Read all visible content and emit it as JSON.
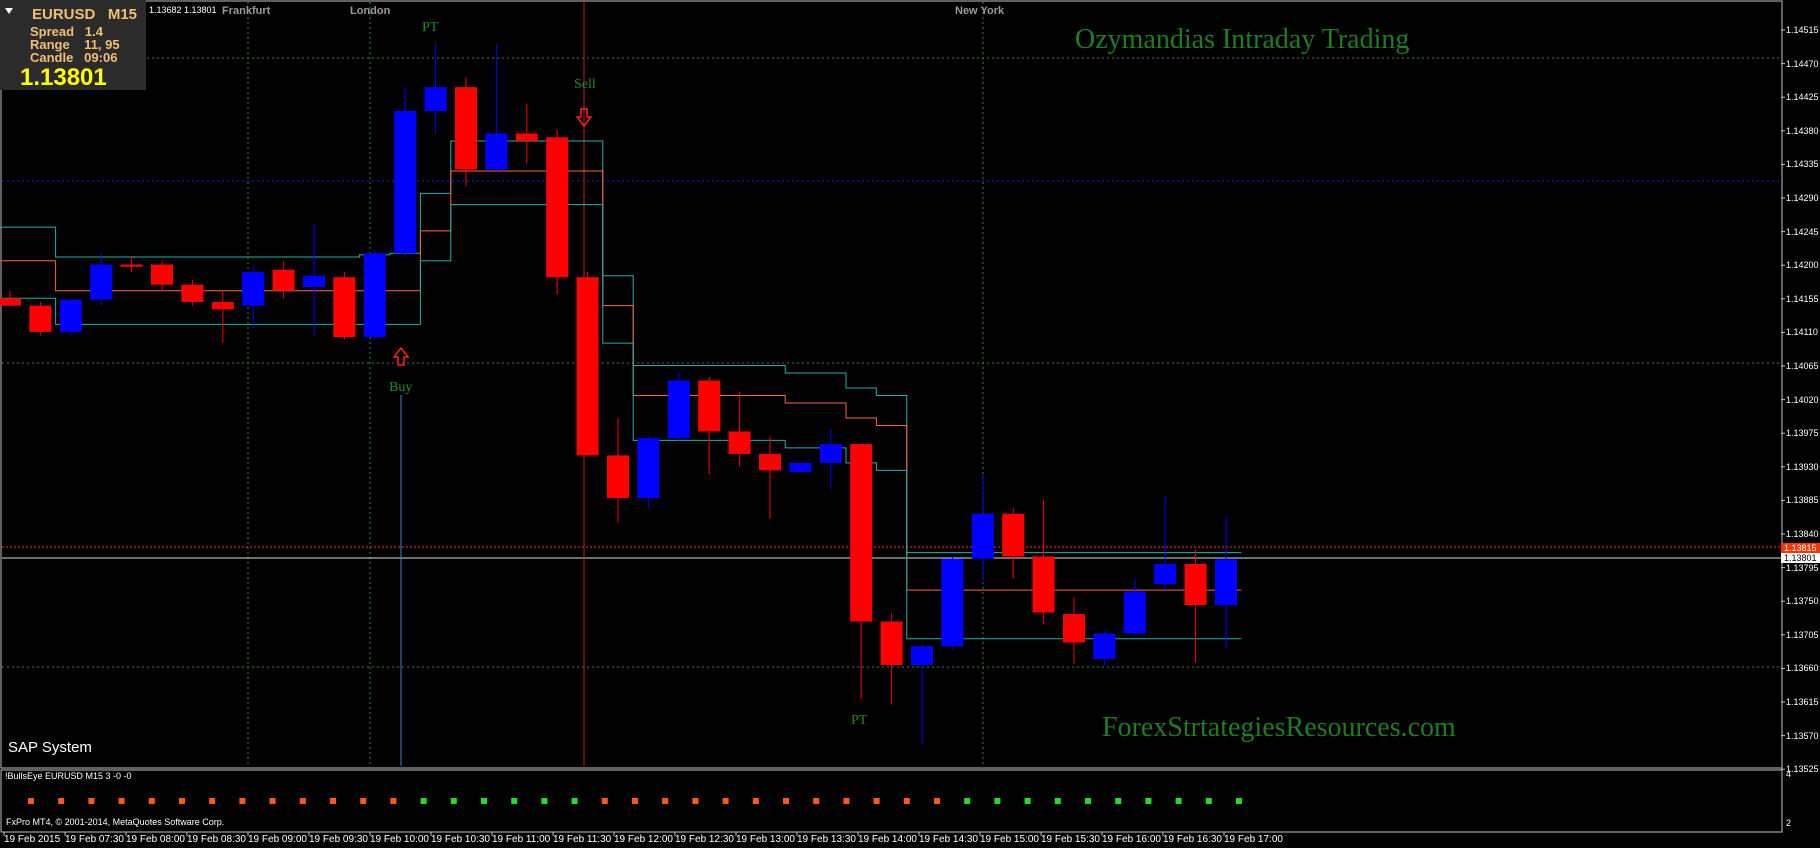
{
  "header": {
    "ohlc": "1.13682 1.13801",
    "symbol_line": "EURUSD   M15",
    "spread_line": "Spread   1.4",
    "range_line": "Range    11, 95",
    "candle_line": "Candle   09:06",
    "current_price": "1.13801"
  },
  "sessions": [
    "Frankfurt",
    "London",
    "New York"
  ],
  "titles": {
    "main": "Ozymandias Intraday Trading",
    "footer": "ForexStrtategiesResources.com",
    "system": "SAP System"
  },
  "signals": {
    "buy": "Buy",
    "sell": "Sell",
    "pt_top": "PT",
    "pt_bottom": "PT"
  },
  "indicator": {
    "label": "!BullsEye EURUSD M15 3 -0 -0",
    "scale_top": "4",
    "scale_bottom": "2",
    "dots_colors": [
      "#ff5a14",
      "#22dd22"
    ],
    "dots": [
      "o",
      "o",
      "o",
      "o",
      "o",
      "o",
      "o",
      "o",
      "o",
      "o",
      "o",
      "o",
      "o",
      "g",
      "g",
      "g",
      "g",
      "g",
      "g",
      "o",
      "o",
      "o",
      "o",
      "o",
      "o",
      "o",
      "o",
      "o",
      "o",
      "o",
      "o",
      "g",
      "g",
      "g",
      "g",
      "g",
      "g",
      "g",
      "g",
      "g",
      "g"
    ]
  },
  "copyright": "FxPro MT4, © 2001-2014, MetaQuotes Software Corp.",
  "price_axis": [
    "1.14515",
    "1.14470",
    "1.14425",
    "1.14380",
    "1.14335",
    "1.14290",
    "1.14245",
    "1.14200",
    "1.14155",
    "1.14110",
    "1.14065",
    "1.14020",
    "1.13975",
    "1.13930",
    "1.13885",
    "1.13840",
    "1.13795",
    "1.13750",
    "1.13705",
    "1.13660",
    "1.13615",
    "1.13570",
    "1.13525"
  ],
  "price_tags": {
    "red": "1.13815",
    "white": "1.13801"
  },
  "time_axis": [
    "19 Feb 2015",
    "19 Feb 07:30",
    "19 Feb 08:00",
    "19 Feb 08:30",
    "19 Feb 09:00",
    "19 Feb 09:30",
    "19 Feb 10:00",
    "19 Feb 10:30",
    "19 Feb 11:00",
    "19 Feb 11:30",
    "19 Feb 12:00",
    "19 Feb 12:30",
    "19 Feb 13:00",
    "19 Feb 13:30",
    "19 Feb 14:00",
    "19 Feb 14:30",
    "19 Feb 15:00",
    "19 Feb 15:30",
    "19 Feb 16:00",
    "19 Feb 16:30",
    "19 Feb 17:00"
  ],
  "colors": {
    "bull": "#0000ff",
    "bear": "#ff0000",
    "band_outer": "#20b2aa",
    "band_mid": "#ff6347",
    "grid": "#2e8b57"
  },
  "chart_data": {
    "type": "candlestick",
    "symbol": "EURUSD",
    "timeframe": "M15",
    "candles": [
      {
        "o": 1.1415,
        "h": 1.1416,
        "l": 1.1414,
        "c": 1.1414
      },
      {
        "o": 1.1414,
        "h": 1.14145,
        "l": 1.141,
        "c": 1.14105
      },
      {
        "o": 1.14105,
        "h": 1.1415,
        "l": 1.141,
        "c": 1.14148
      },
      {
        "o": 1.14148,
        "h": 1.1421,
        "l": 1.1414,
        "c": 1.14195
      },
      {
        "o": 1.14195,
        "h": 1.14205,
        "l": 1.14185,
        "c": 1.14192
      },
      {
        "o": 1.14195,
        "h": 1.142,
        "l": 1.1416,
        "c": 1.14168
      },
      {
        "o": 1.14168,
        "h": 1.14175,
        "l": 1.1414,
        "c": 1.14145
      },
      {
        "o": 1.14145,
        "h": 1.1416,
        "l": 1.1409,
        "c": 1.14135
      },
      {
        "o": 1.1414,
        "h": 1.14195,
        "l": 1.1411,
        "c": 1.14185
      },
      {
        "o": 1.14188,
        "h": 1.142,
        "l": 1.1415,
        "c": 1.1416
      },
      {
        "o": 1.14165,
        "h": 1.1425,
        "l": 1.141,
        "c": 1.1418
      },
      {
        "o": 1.14178,
        "h": 1.14185,
        "l": 1.14095,
        "c": 1.14098
      },
      {
        "o": 1.14098,
        "h": 1.14215,
        "l": 1.14095,
        "c": 1.1421
      },
      {
        "o": 1.1421,
        "h": 1.14432,
        "l": 1.14205,
        "c": 1.144
      },
      {
        "o": 1.144,
        "h": 1.1449,
        "l": 1.1437,
        "c": 1.14432
      },
      {
        "o": 1.14432,
        "h": 1.14445,
        "l": 1.143,
        "c": 1.14322
      },
      {
        "o": 1.14322,
        "h": 1.1449,
        "l": 1.1432,
        "c": 1.1437
      },
      {
        "o": 1.1437,
        "h": 1.1441,
        "l": 1.1433,
        "c": 1.1436
      },
      {
        "o": 1.14365,
        "h": 1.14375,
        "l": 1.14155,
        "c": 1.14178
      },
      {
        "o": 1.14178,
        "h": 1.14185,
        "l": 1.13945,
        "c": 1.1394
      },
      {
        "o": 1.1394,
        "h": 1.1399,
        "l": 1.1385,
        "c": 1.13883
      },
      {
        "o": 1.13883,
        "h": 1.13965,
        "l": 1.1387,
        "c": 1.13963
      },
      {
        "o": 1.13963,
        "h": 1.1405,
        "l": 1.1396,
        "c": 1.1404
      },
      {
        "o": 1.1404,
        "h": 1.14045,
        "l": 1.13915,
        "c": 1.13972
      },
      {
        "o": 1.13972,
        "h": 1.14025,
        "l": 1.13925,
        "c": 1.13942
      },
      {
        "o": 1.13942,
        "h": 1.13965,
        "l": 1.13855,
        "c": 1.1392
      },
      {
        "o": 1.13918,
        "h": 1.1393,
        "l": 1.13917,
        "c": 1.1393
      },
      {
        "o": 1.1393,
        "h": 1.13975,
        "l": 1.13895,
        "c": 1.13955
      },
      {
        "o": 1.13955,
        "h": 1.13955,
        "l": 1.13615,
        "c": 1.13718
      },
      {
        "o": 1.13718,
        "h": 1.13728,
        "l": 1.13607,
        "c": 1.1366
      },
      {
        "o": 1.1366,
        "h": 1.13688,
        "l": 1.13555,
        "c": 1.13685
      },
      {
        "o": 1.13685,
        "h": 1.13805,
        "l": 1.1368,
        "c": 1.13802
      },
      {
        "o": 1.13802,
        "h": 1.13915,
        "l": 1.1377,
        "c": 1.13862
      },
      {
        "o": 1.13862,
        "h": 1.1387,
        "l": 1.13775,
        "c": 1.13805
      },
      {
        "o": 1.13805,
        "h": 1.1388,
        "l": 1.13715,
        "c": 1.1373
      },
      {
        "o": 1.13728,
        "h": 1.1375,
        "l": 1.13662,
        "c": 1.1369
      },
      {
        "o": 1.13668,
        "h": 1.13705,
        "l": 1.1366,
        "c": 1.13702
      },
      {
        "o": 1.13702,
        "h": 1.13775,
        "l": 1.137,
        "c": 1.13758
      },
      {
        "o": 1.13768,
        "h": 1.13885,
        "l": 1.1376,
        "c": 1.13795
      },
      {
        "o": 1.13795,
        "h": 1.13815,
        "l": 1.13663,
        "c": 1.1374
      },
      {
        "o": 1.1374,
        "h": 1.13858,
        "l": 1.13682,
        "c": 1.13801
      }
    ],
    "band_upper": [
      1.14245,
      1.14245,
      1.14205,
      1.14205,
      1.14205,
      1.14205,
      1.14205,
      1.14205,
      1.14205,
      1.14205,
      1.14205,
      1.14205,
      1.14208,
      1.1421,
      1.1429,
      1.1436,
      1.1436,
      1.1436,
      1.1436,
      1.1436,
      1.1418,
      1.1406,
      1.1406,
      1.1406,
      1.1406,
      1.1406,
      1.1405,
      1.1405,
      1.1403,
      1.1402,
      1.1381,
      1.1381,
      1.1381,
      1.1381,
      1.1381,
      1.1381,
      1.1381,
      1.1381,
      1.1381,
      1.1381,
      1.1381
    ],
    "band_mid": [
      1.142,
      1.142,
      1.1416,
      1.1416,
      1.1416,
      1.1416,
      1.1416,
      1.1416,
      1.1416,
      1.1416,
      1.1416,
      1.1416,
      1.1416,
      1.1416,
      1.1424,
      1.1432,
      1.1432,
      1.1432,
      1.1432,
      1.1432,
      1.1414,
      1.1402,
      1.1402,
      1.1402,
      1.1402,
      1.1402,
      1.1401,
      1.1401,
      1.1399,
      1.1398,
      1.1376,
      1.1376,
      1.1376,
      1.1376,
      1.1376,
      1.1376,
      1.1376,
      1.1376,
      1.1376,
      1.1376,
      1.1376
    ],
    "band_lower": [
      1.1415,
      1.1415,
      1.14115,
      1.14115,
      1.14115,
      1.14115,
      1.14115,
      1.14115,
      1.14115,
      1.14115,
      1.14115,
      1.14115,
      1.14115,
      1.14115,
      1.142,
      1.14275,
      1.14275,
      1.14275,
      1.14275,
      1.14275,
      1.1409,
      1.1396,
      1.1396,
      1.1396,
      1.1396,
      1.1396,
      1.1395,
      1.1395,
      1.1393,
      1.1392,
      1.13695,
      1.13695,
      1.13695,
      1.13695,
      1.13695,
      1.13695,
      1.13695,
      1.13695,
      1.13695,
      1.13695,
      1.13695
    ],
    "y_range": [
      1.13525,
      1.14515
    ]
  }
}
